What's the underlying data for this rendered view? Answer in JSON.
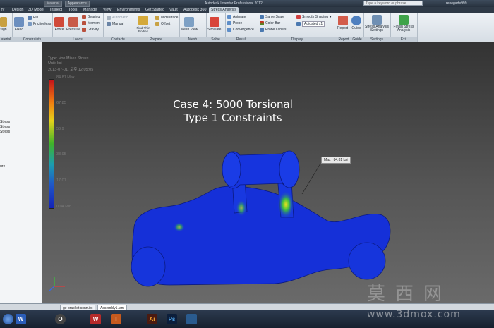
{
  "titlebar": {
    "qat_boxes": [
      "Material",
      "Appearance"
    ],
    "app_title": "Autodesk Inventor Professional 2012",
    "search_placeholder": "Type a keyword or phrase",
    "user": "renegade999"
  },
  "tabs": [
    "ify",
    "Design",
    "3D Model",
    "Inspect",
    "Tools",
    "Manage",
    "View",
    "Environments",
    "Get Started",
    "Vault",
    "Autodesk 360",
    "Stress Analysis"
  ],
  "active_tab": "Stress Analysis",
  "ribbon": {
    "panels": {
      "material": "aterial",
      "constraints": "Constraints",
      "loads": "Loads",
      "contacts": "Contacts",
      "prepare": "Prepare",
      "mesh": "Mesh",
      "solve": "Solve",
      "result": "Result",
      "display": "Display",
      "report": "Report",
      "guide": "Guide",
      "settings": "Settings",
      "exit": "Exit"
    },
    "buttons": {
      "assign": "sign",
      "fixed": "Fixed",
      "pin": "Pin",
      "frictionless": "Frictionless",
      "force": "Force",
      "pressure": "Pressure",
      "bearing": "Bearing",
      "moment": "Moment",
      "gravity": "Gravity",
      "automatic": "Automatic",
      "manual": "Manual",
      "find_thin_bodies": "Find Thin Bodies",
      "midsurface": "Midsurface",
      "offset": "Offset",
      "mesh_view": "Mesh View",
      "simulate": "Simulate",
      "animate": "Animate",
      "probe": "Probe",
      "convergence": "Convergence",
      "same_scale": "Same Scale",
      "color_bar": "Color Bar",
      "probe_labels": "Probe Labels",
      "smooth_shading": "Smooth Shading",
      "adjusted": "Adjusted x1",
      "report": "Report",
      "guide": "Guide",
      "stress_settings": "Stress Analysis Settings",
      "finish": "Finish Stress Analysis"
    }
  },
  "browser": {
    "items": [
      "Stress",
      "Stress",
      "Stress",
      "ure"
    ]
  },
  "viewport": {
    "meta": [
      "Type: Von Mises Stress",
      "Unit: ksi",
      "2013-07-01, 오후 12:05:05"
    ],
    "legend": [
      {
        "label": "84.81 Max"
      },
      {
        "label": "67.85"
      },
      {
        "label": "50.9"
      },
      {
        "label": "33.95"
      },
      {
        "label": "17.01"
      },
      {
        "label": "0.04 Min"
      }
    ],
    "case_title_line1": "Case 4: 5000 Torsional",
    "case_title_line2": "Type 1 Constraints",
    "max_callout": "Max : 84.81 ksi"
  },
  "doc_tabs": [
    "ge bracket conn.ipt",
    "Assembly1.iam"
  ],
  "taskbar": [
    "W",
    "O",
    "W",
    "I",
    "Ai",
    "Ps"
  ],
  "watermark": {
    "big": "莫西网",
    "url": "www.3dmox.com"
  },
  "colors": {
    "mesh_blue": "#1530d8",
    "accent": "#2f3a47"
  }
}
